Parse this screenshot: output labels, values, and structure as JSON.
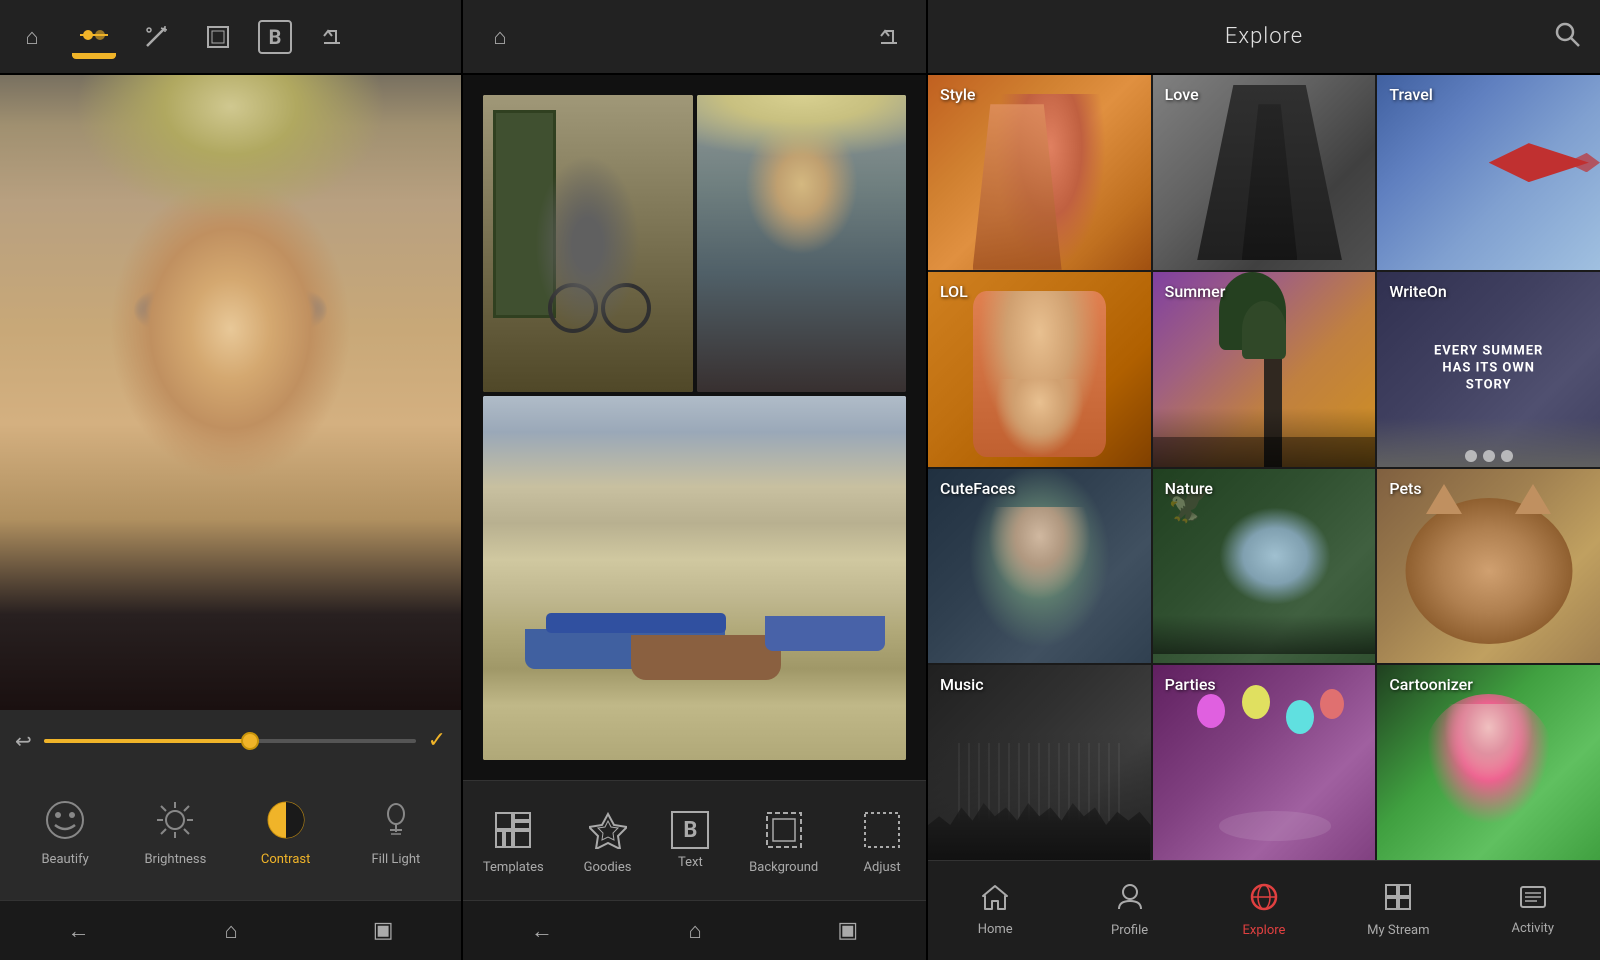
{
  "panel1": {
    "toolbar": {
      "home_icon": "⌂",
      "adjust_icon": "⚙",
      "magic_icon": "✦",
      "frame_icon": "▢",
      "bold_icon": "B",
      "share_icon": "⤴"
    },
    "slider": {
      "value": 55
    },
    "tools": [
      {
        "id": "beautify",
        "label": "Beautify",
        "icon": "☺",
        "active": false
      },
      {
        "id": "brightness",
        "label": "Brightness",
        "icon": "☀",
        "active": false
      },
      {
        "id": "contrast",
        "label": "Contrast",
        "icon": "◑",
        "active": true
      },
      {
        "id": "filllight",
        "label": "Fill Light",
        "icon": "💡",
        "active": false
      },
      {
        "id": "more",
        "label": "...",
        "icon": "…",
        "active": false
      }
    ],
    "nav": {
      "back": "←",
      "home": "⌂",
      "recent": "▣"
    }
  },
  "panel2": {
    "toolbar": {
      "home_icon": "⌂",
      "share_icon": "⤴"
    },
    "tools": [
      {
        "id": "templates",
        "label": "Templates",
        "icon": "⊞",
        "active": false
      },
      {
        "id": "goodies",
        "label": "Goodies",
        "icon": "◈",
        "active": false
      },
      {
        "id": "text",
        "label": "Text",
        "icon": "B",
        "active": false
      },
      {
        "id": "background",
        "label": "Background",
        "icon": "⬚",
        "active": false
      },
      {
        "id": "adjust",
        "label": "Adjust",
        "icon": "⬜",
        "active": false
      }
    ],
    "nav": {
      "back": "←",
      "home": "⌂",
      "recent": "▣"
    }
  },
  "panel3": {
    "header": {
      "title": "Explore",
      "search_icon": "🔍"
    },
    "categories": [
      {
        "id": "style",
        "label": "Style",
        "bg": "style"
      },
      {
        "id": "love",
        "label": "Love",
        "bg": "love"
      },
      {
        "id": "travel",
        "label": "Travel",
        "bg": "travel"
      },
      {
        "id": "lol",
        "label": "LOL",
        "bg": "lol"
      },
      {
        "id": "summer",
        "label": "Summer",
        "bg": "summer"
      },
      {
        "id": "writeon",
        "label": "WriteOn",
        "bg": "writeon",
        "subtext": "EVERY SUMMER HAS ITS OWN STORY"
      },
      {
        "id": "cutefaces",
        "label": "CuteFaces",
        "bg": "cutefaces"
      },
      {
        "id": "nature",
        "label": "Nature",
        "bg": "nature"
      },
      {
        "id": "pets",
        "label": "Pets",
        "bg": "pets"
      },
      {
        "id": "music",
        "label": "Music",
        "bg": "music"
      },
      {
        "id": "parties",
        "label": "Parties",
        "bg": "parties"
      },
      {
        "id": "cartoonizer",
        "label": "Cartoonizer",
        "bg": "cartoonizer"
      }
    ],
    "nav": [
      {
        "id": "home",
        "label": "Home",
        "icon": "⌂",
        "active": false
      },
      {
        "id": "profile",
        "label": "Profile",
        "icon": "👤",
        "active": false
      },
      {
        "id": "explore",
        "label": "Explore",
        "icon": "🌐",
        "active": true
      },
      {
        "id": "mystream",
        "label": "My Stream",
        "icon": "⊞",
        "active": false
      },
      {
        "id": "activity",
        "label": "Activity",
        "icon": "☰",
        "active": false
      }
    ]
  }
}
